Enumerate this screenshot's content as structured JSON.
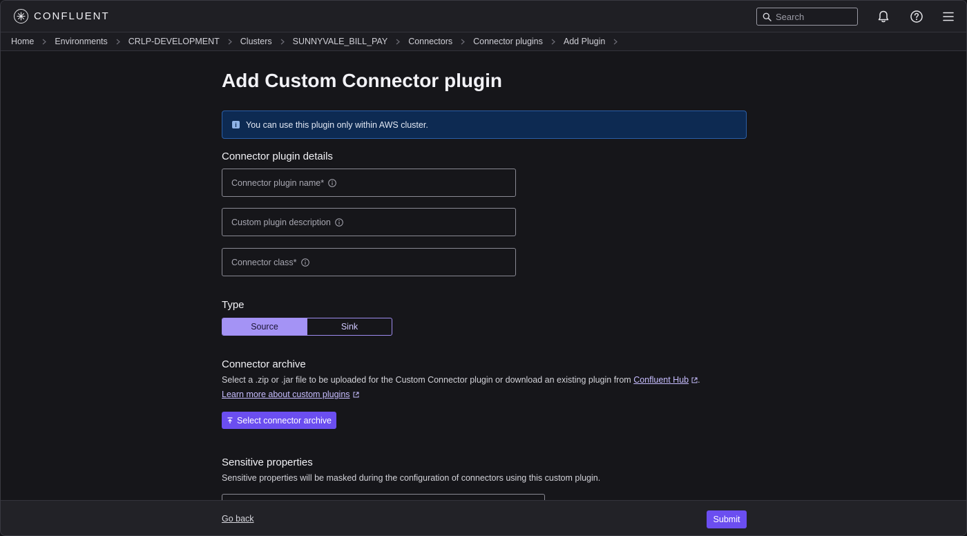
{
  "app": {
    "brand": "CONFLUENT",
    "brand_icon": "confluent-logo-icon"
  },
  "topbar": {
    "search_placeholder": "Search",
    "icons": [
      "search-icon",
      "bell-icon",
      "help-icon",
      "menu-icon"
    ]
  },
  "breadcrumb": [
    {
      "label": "Home"
    },
    {
      "label": "Environments"
    },
    {
      "label": "CRLP-DEVELOPMENT"
    },
    {
      "label": "Clusters"
    },
    {
      "label": "SUNNYVALE_BILL_PAY"
    },
    {
      "label": "Connectors"
    },
    {
      "label": "Connector plugins"
    },
    {
      "label": "Add Plugin"
    }
  ],
  "page": {
    "title": "Add Custom Connector plugin",
    "info_banner": "You can use this plugin only within AWS cluster."
  },
  "plugin_details": {
    "heading": "Connector plugin details",
    "fields": [
      {
        "label": "Connector plugin name*",
        "value": ""
      },
      {
        "label": "Custom plugin description",
        "value": ""
      },
      {
        "label": "Connector class*",
        "value": ""
      }
    ]
  },
  "type": {
    "heading": "Type",
    "options": [
      "Source",
      "Sink"
    ],
    "selected": "Source"
  },
  "archive": {
    "heading": "Connector archive",
    "description": "Select a .zip or .jar file to be uploaded for the Custom Connector plugin or download an existing plugin from",
    "hub_link": "Confluent Hub",
    "period": ".",
    "learn_more": "Learn more about custom plugins",
    "button": "Select connector archive"
  },
  "sensitive": {
    "heading": "Sensitive properties",
    "description": "Sensitive properties will be masked during the configuration of connectors using this custom plugin."
  },
  "footer": {
    "back": "Go back",
    "submit": "Submit"
  },
  "colors": {
    "accent": "#6b4ef0",
    "segment_active": "#a493f5",
    "info_bg": "#0d2a52",
    "background": "#16161a"
  }
}
